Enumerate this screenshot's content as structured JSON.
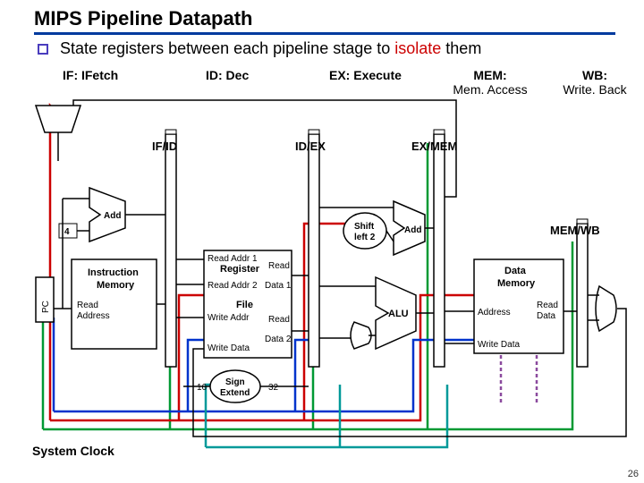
{
  "title": "MIPS Pipeline Datapath",
  "desc_prefix": "State registers between each pipeline stage to ",
  "desc_isolate": "isolate",
  "desc_suffix": " them",
  "stages": {
    "if": "IF: IFetch",
    "id": "ID: Dec",
    "ex": "EX: Execute",
    "mem": "MEM:",
    "mem_sub": "Mem. Access",
    "wb": "WB:",
    "wb_sub": "Write. Back"
  },
  "pipe_regs": {
    "ifid": "IF/ID",
    "idex": "ID/EX",
    "exmem": "EX/MEM",
    "memwb": "MEM/WB"
  },
  "blocks": {
    "pc": "PC",
    "instr_mem_l1": "Instruction",
    "instr_mem_l2": "Memory",
    "read_addr_l1": "Read",
    "read_addr_l2": "Address",
    "const4": "4",
    "add1": "Add",
    "add2": "Add",
    "shift_l1": "Shift",
    "shift_l2": "left 2",
    "reg_title": "Register",
    "reg_file": "File",
    "read_addr1": "Read Addr 1",
    "read_addr2": "Read Addr 2",
    "write_addr": "Write Addr",
    "write_data": "Write Data",
    "read_data1_l1": "Read",
    "read_data1_l2": "Data 1",
    "read_data2_l1": "Read",
    "read_data2_l2": "Data 2",
    "sign_l1": "Sign",
    "sign_l2": "Extend",
    "sixteen": "16",
    "thirtytwo": "32",
    "alu": "ALU",
    "dmem_l1": "Data",
    "dmem_l2": "Memory",
    "dmem_addr": "Address",
    "dmem_wd": "Write Data",
    "dmem_rd_l1": "Read",
    "dmem_rd_l2": "Data"
  },
  "footer": {
    "clock": "System Clock",
    "page": "26"
  },
  "colors": {
    "green": "#009933",
    "red": "#cc0000",
    "blue": "#0033cc",
    "teal": "#009999",
    "purple": "#8b4a9e"
  }
}
